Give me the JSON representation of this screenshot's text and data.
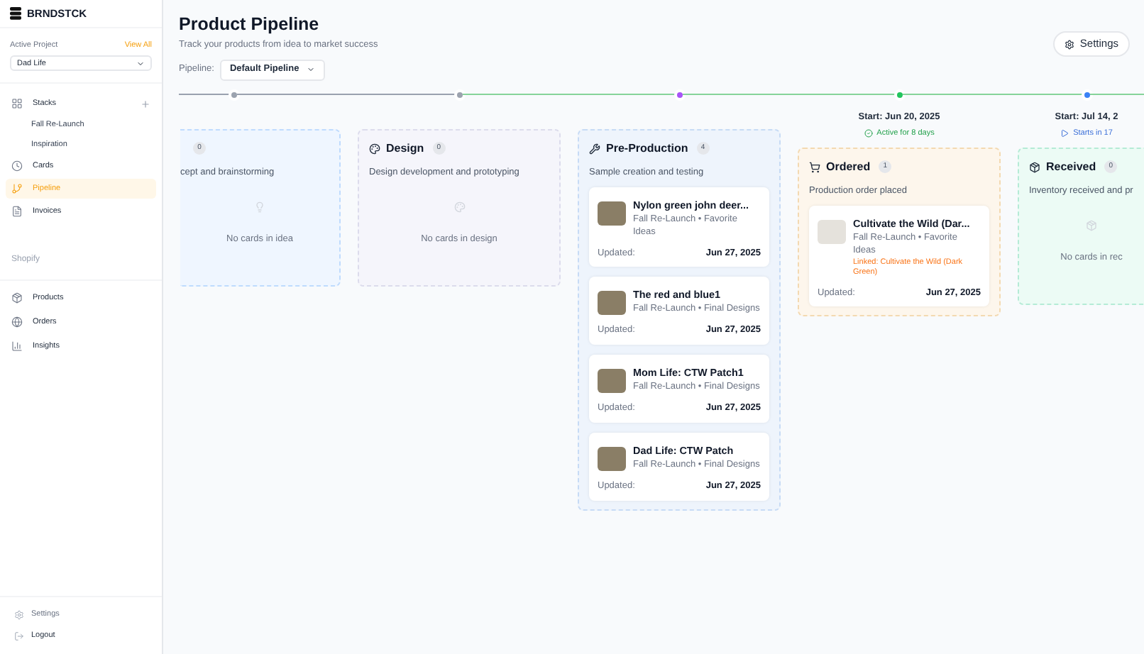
{
  "brand": {
    "name": "BRNDSTCK"
  },
  "project": {
    "label": "Active Project",
    "view_all": "View All",
    "value": "Dad Life"
  },
  "nav": [
    {
      "kind": "stacks",
      "label": "Stacks",
      "selected": false,
      "children": [
        {
          "label": "Fall Re-Launch"
        },
        {
          "label": "Inspiration"
        }
      ]
    },
    {
      "kind": "cards",
      "label": "Cards",
      "selected": false
    },
    {
      "kind": "pipeline",
      "label": "Pipeline",
      "selected": true
    },
    {
      "kind": "invoices",
      "label": "Invoices",
      "selected": false
    }
  ],
  "shopify": {
    "heading": "Shopify",
    "items": [
      {
        "kind": "products",
        "label": "Products"
      },
      {
        "kind": "orders",
        "label": "Orders"
      },
      {
        "kind": "insights",
        "label": "Insights"
      }
    ]
  },
  "bottom": [
    {
      "kind": "settings",
      "label": "Settings"
    },
    {
      "kind": "logout",
      "label": "Logout"
    }
  ],
  "header": {
    "title": "Product Pipeline",
    "subtitle": "Track your products from idea to market success",
    "pipeline_label": "Pipeline:",
    "pipeline_value": "Default Pipeline",
    "settings": "Settings"
  },
  "stages": [
    {
      "kind": "idea",
      "count": "0",
      "description": "cept and brainstorming",
      "empty": "No cards in idea",
      "color": "#9ca3af"
    },
    {
      "kind": "design",
      "name": "Design",
      "count": "0",
      "description": "Design development and prototyping",
      "empty": "No cards in design",
      "color": "#9ca3af"
    },
    {
      "kind": "preproduction",
      "name": "Pre-Production",
      "count": "4",
      "description": "Sample creation and testing",
      "color": "#a855f7",
      "cards": [
        {
          "title": "Nylon green john deer...",
          "subtitle": "Fall Re-Launch • Favorite Ideas",
          "updated": "Updated:",
          "date": "Jun 27, 2025"
        },
        {
          "title": "The red and blue1",
          "subtitle": "Fall Re-Launch • Final Designs",
          "updated": "Updated:",
          "date": "Jun 27, 2025"
        },
        {
          "title": "Mom Life: CTW Patch1",
          "subtitle": "Fall Re-Launch • Final Designs",
          "updated": "Updated:",
          "date": "Jun 27, 2025"
        },
        {
          "title": "Dad Life: CTW Patch",
          "subtitle": "Fall Re-Launch • Final Designs",
          "updated": "Updated:",
          "date": "Jun 27, 2025"
        }
      ]
    },
    {
      "kind": "ordered",
      "name": "Ordered",
      "count": "1",
      "description": "Production order placed",
      "color": "#22c55e",
      "start": "Start: Jun 20, 2025",
      "status": {
        "kind": "active",
        "text": "Active for 8 days"
      },
      "cards": [
        {
          "title": "Cultivate the Wild (Dar...",
          "subtitle": "Fall Re-Launch • Favorite Ideas",
          "linked": "Linked: Cultivate the Wild (Dark Green)",
          "updated": "Updated:",
          "date": "Jun 27, 2025"
        }
      ]
    },
    {
      "kind": "received",
      "name": "Received",
      "count": "0",
      "description": "Inventory received and pr",
      "empty": "No cards in rec",
      "color": "#3b82f6",
      "start": "Start: Jul 14, 2",
      "status": {
        "kind": "upcoming",
        "text": "Starts in 17"
      }
    }
  ]
}
